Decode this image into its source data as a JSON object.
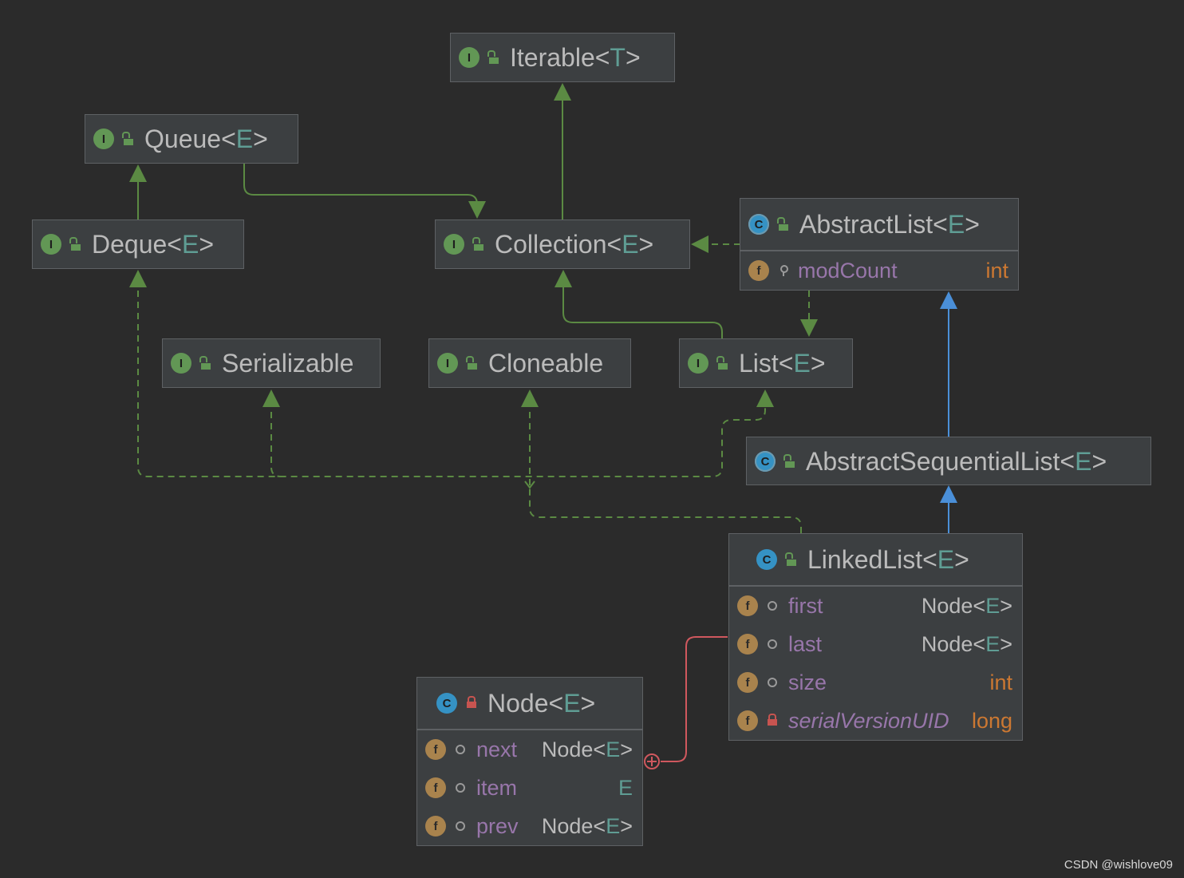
{
  "nodes": {
    "iterable": {
      "name": "Iterable",
      "type_param": "T",
      "kind": "interface"
    },
    "queue": {
      "name": "Queue",
      "type_param": "E",
      "kind": "interface"
    },
    "deque": {
      "name": "Deque",
      "type_param": "E",
      "kind": "interface"
    },
    "collection": {
      "name": "Collection",
      "type_param": "E",
      "kind": "interface"
    },
    "abstractlist": {
      "name": "AbstractList",
      "type_param": "E",
      "kind": "abstract-class",
      "fields": [
        {
          "name": "modCount",
          "type": "int",
          "visibility": "protected"
        }
      ]
    },
    "serializable": {
      "name": "Serializable",
      "kind": "interface"
    },
    "cloneable": {
      "name": "Cloneable",
      "kind": "interface"
    },
    "list": {
      "name": "List",
      "type_param": "E",
      "kind": "interface"
    },
    "abstractsequentiallist": {
      "name": "AbstractSequentialList",
      "type_param": "E",
      "kind": "abstract-class"
    },
    "linkedlist": {
      "name": "LinkedList",
      "type_param": "E",
      "kind": "class",
      "fields": [
        {
          "name": "first",
          "type_base": "Node",
          "type_param": "E",
          "visibility": "package"
        },
        {
          "name": "last",
          "type_base": "Node",
          "type_param": "E",
          "visibility": "package"
        },
        {
          "name": "size",
          "type": "int",
          "visibility": "package"
        },
        {
          "name": "serialVersionUID",
          "type": "long",
          "visibility": "private",
          "static": true
        }
      ]
    },
    "node": {
      "name": "Node",
      "type_param": "E",
      "kind": "inner-class",
      "fields": [
        {
          "name": "next",
          "type_base": "Node",
          "type_param": "E",
          "visibility": "package"
        },
        {
          "name": "item",
          "type_param_only": "E",
          "visibility": "package"
        },
        {
          "name": "prev",
          "type_base": "Node",
          "type_param": "E",
          "visibility": "package"
        }
      ]
    }
  },
  "edges": [
    {
      "from": "collection",
      "to": "iterable",
      "style": "extends-interface"
    },
    {
      "from": "deque",
      "to": "queue",
      "style": "extends-interface"
    },
    {
      "from": "queue",
      "to": "collection",
      "style": "extends-interface"
    },
    {
      "from": "abstractlist",
      "to": "collection",
      "style": "implements"
    },
    {
      "from": "abstractlist",
      "to": "list",
      "style": "implements"
    },
    {
      "from": "list",
      "to": "collection",
      "style": "extends-interface"
    },
    {
      "from": "abstractsequentiallist",
      "to": "abstractlist",
      "style": "extends-class"
    },
    {
      "from": "linkedlist",
      "to": "abstractsequentiallist",
      "style": "extends-class"
    },
    {
      "from": "linkedlist",
      "to": "deque",
      "style": "implements"
    },
    {
      "from": "linkedlist",
      "to": "serializable",
      "style": "implements"
    },
    {
      "from": "linkedlist",
      "to": "cloneable",
      "style": "implements"
    },
    {
      "from": "linkedlist",
      "to": "list",
      "style": "implements"
    },
    {
      "from": "node",
      "to": "linkedlist",
      "style": "inner-class"
    }
  ],
  "colors": {
    "background": "#2b2b2b",
    "interface_edge": "#5b8a43",
    "class_edge": "#4a8fd8",
    "inner_edge": "#d0585e",
    "field_name": "#9876aa",
    "keyword_type": "#cc7832",
    "type_param": "#5f9d94"
  },
  "watermark": "CSDN @wishlove09"
}
